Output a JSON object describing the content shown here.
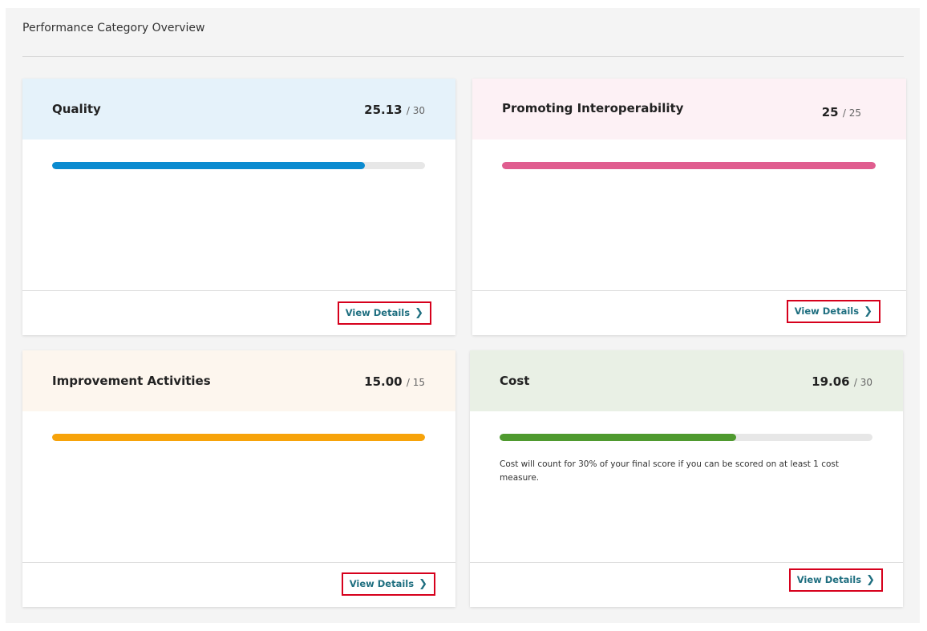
{
  "panel": {
    "title": "Performance Category Overview"
  },
  "cards": [
    {
      "name": "Quality",
      "score": "25.13",
      "max": "/ 30",
      "progress": 0.838,
      "header_color": "#e5f2fa",
      "bar_color": "#0b8bd0",
      "note": "",
      "link": "View Details"
    },
    {
      "name": "Promoting Interoperability",
      "score": "25",
      "max": "/ 25",
      "progress": 1.0,
      "header_color": "#fdf1f5",
      "bar_color": "#e05d8f",
      "note": "",
      "link": "View Details"
    },
    {
      "name": "Improvement Activities",
      "score": "15.00",
      "max": "/ 15",
      "progress": 1.0,
      "header_color": "#fdf6ee",
      "bar_color": "#f7a30a",
      "note": "",
      "link": "View Details"
    },
    {
      "name": "Cost",
      "score": "19.06",
      "max": "/ 30",
      "progress": 0.635,
      "header_color": "#e9f0e5",
      "bar_color": "#4f9a2f",
      "note": "Cost will count for 30% of your final score if you can be scored on at least 1 cost measure.",
      "link": "View Details"
    }
  ]
}
